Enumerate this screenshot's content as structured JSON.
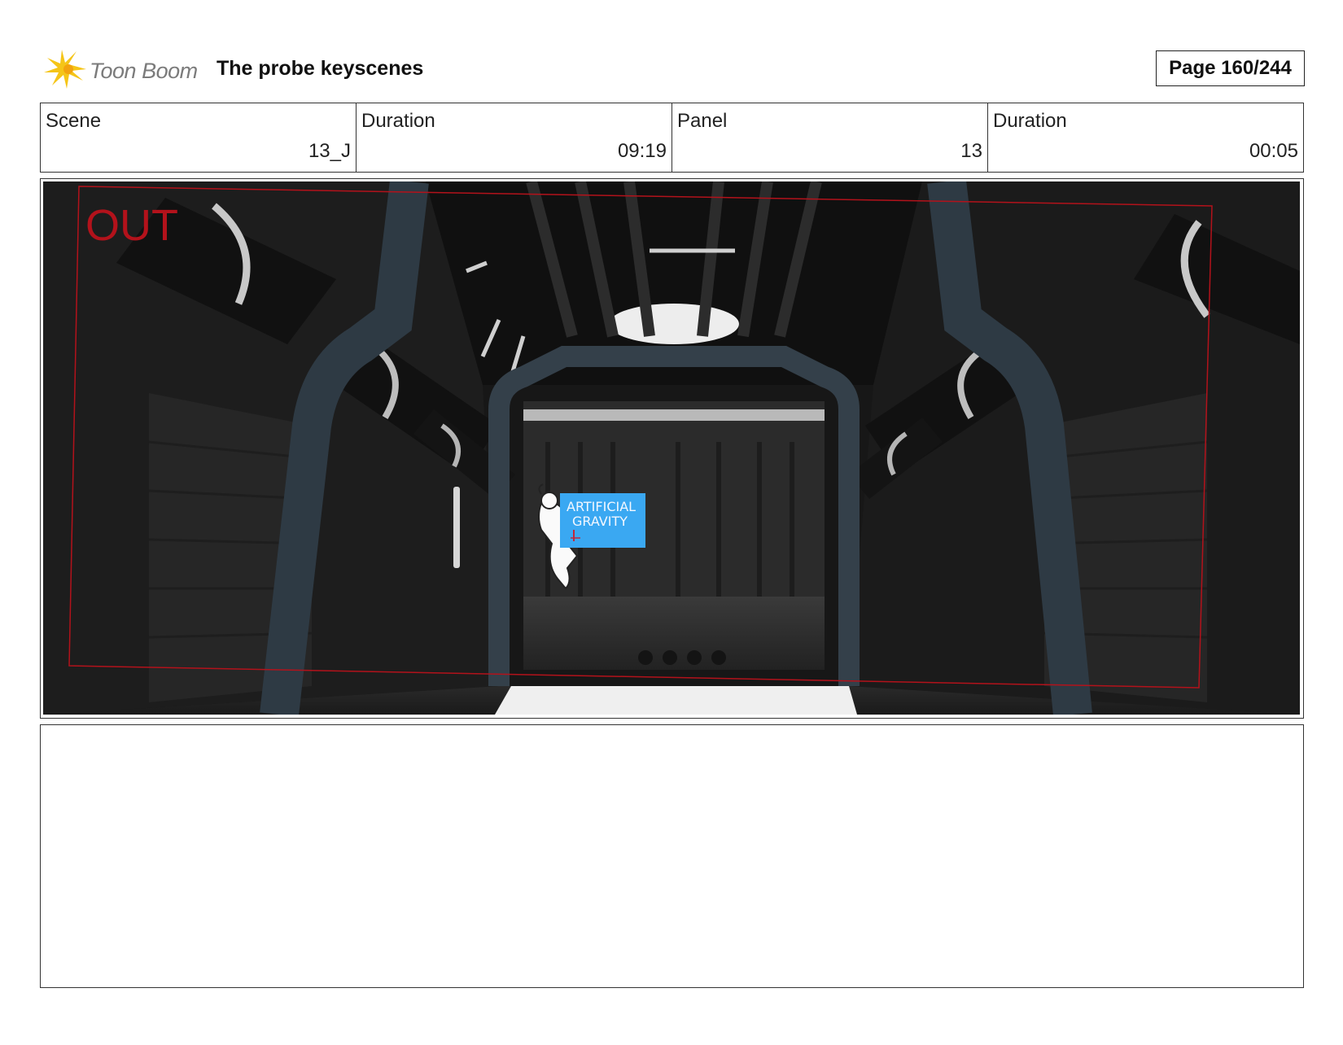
{
  "header": {
    "logo_text": "Toon Boom",
    "title": "The probe keyscenes",
    "page_label": "Page 160/244"
  },
  "info": [
    {
      "label": "Scene",
      "value": "13_J"
    },
    {
      "label": "Duration",
      "value": "09:19"
    },
    {
      "label": "Panel",
      "value": "13"
    },
    {
      "label": "Duration",
      "value": "00:05"
    }
  ],
  "panel": {
    "out_label": "OUT",
    "sign_line1": "ARTIFICIAL",
    "sign_line2": "GRAVITY"
  },
  "colors": {
    "frame_red": "#b3121b",
    "sign_blue": "#3aa8f2",
    "logo_yellow": "#f5c518"
  }
}
